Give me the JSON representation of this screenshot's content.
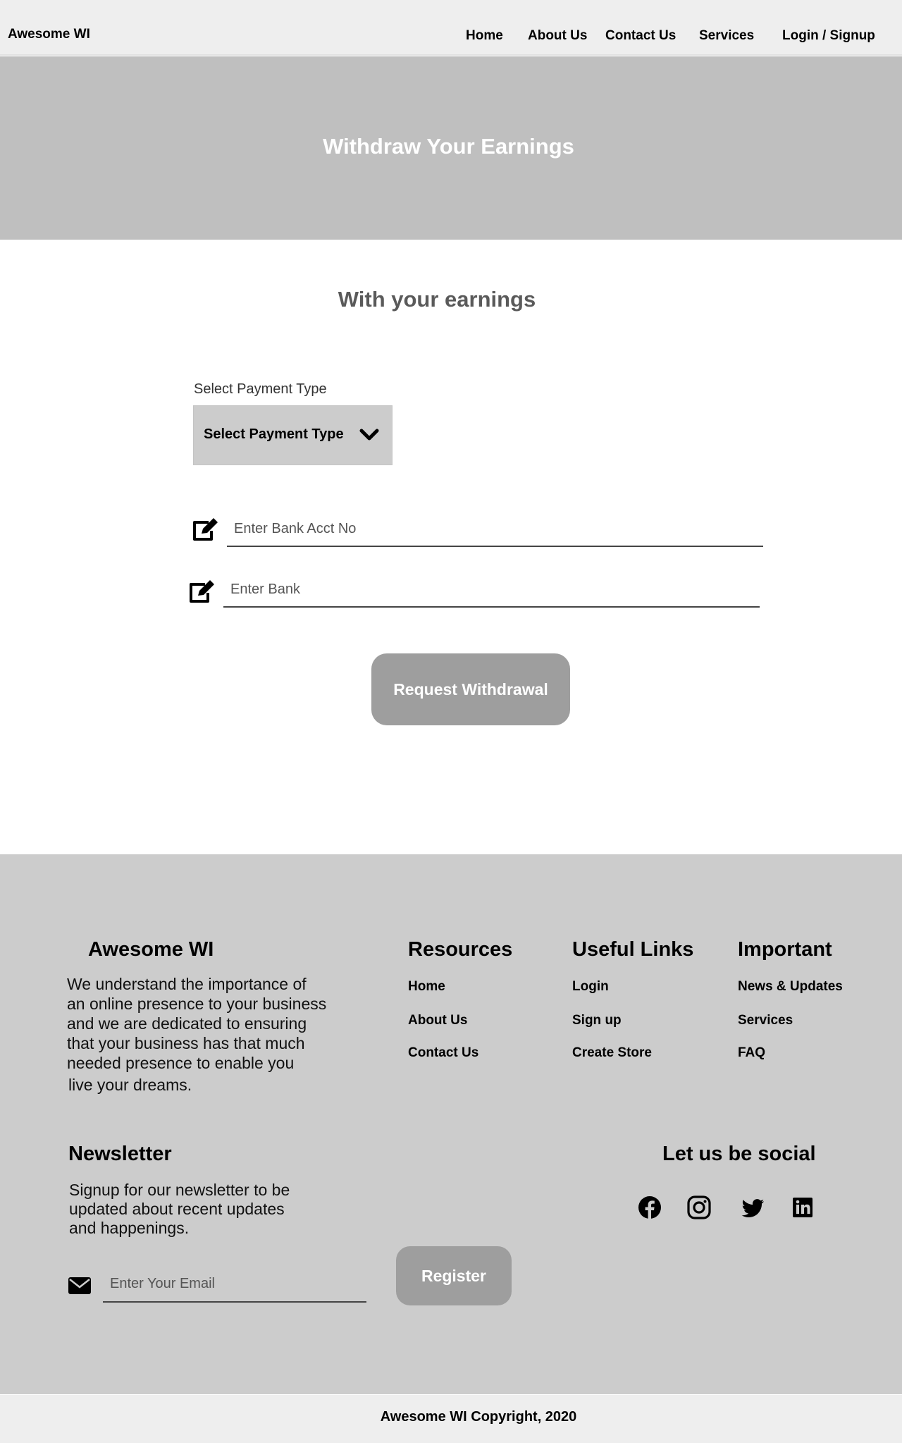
{
  "header": {
    "brand": "Awesome WI",
    "nav": {
      "home": "Home",
      "about": "About Us",
      "contact": "Contact Us",
      "services": "Services",
      "login": "Login / Signup"
    }
  },
  "hero": {
    "title": "Withdraw Your Earnings"
  },
  "main": {
    "subtitle": "With your earnings",
    "payment_type_label": "Select Payment Type",
    "payment_type_value": "Select Payment Type",
    "bank_acct_placeholder": "Enter Bank Acct No",
    "bank_placeholder": "Enter Bank",
    "request_button": "Request Withdrawal"
  },
  "footer": {
    "about": {
      "title": "Awesome WI",
      "lines": [
        "We understand the importance of",
        "an online presence to your business",
        "and we are dedicated to ensuring",
        "that your business has that much",
        "needed presence to enable you",
        "live your dreams."
      ]
    },
    "resources": {
      "title": "Resources",
      "links": [
        "Home",
        "About Us",
        "Contact Us"
      ]
    },
    "useful_links": {
      "title": "Useful Links",
      "links": [
        "Login",
        "Sign up",
        "Create Store"
      ]
    },
    "important": {
      "title": "Important",
      "links": [
        "News & Updates",
        "Services",
        "FAQ"
      ]
    },
    "newsletter": {
      "title": "Newsletter",
      "lines": [
        "Signup for our newsletter to be",
        "updated about recent updates",
        "and happenings."
      ],
      "email_placeholder": "Enter Your Email",
      "register_button": "Register"
    },
    "social": {
      "title": "Let us be social",
      "icons": [
        "facebook-icon",
        "instagram-icon",
        "twitter-icon",
        "linkedin-icon"
      ]
    },
    "copyright": "Awesome WI Copyright, 2020"
  },
  "colors": {
    "header_bg": "#eeeeee",
    "hero_bg": "#bfbfbf",
    "footer_bg": "#cccccc",
    "button_bg": "#9e9e9e",
    "subtitle": "#5a5a5a"
  }
}
